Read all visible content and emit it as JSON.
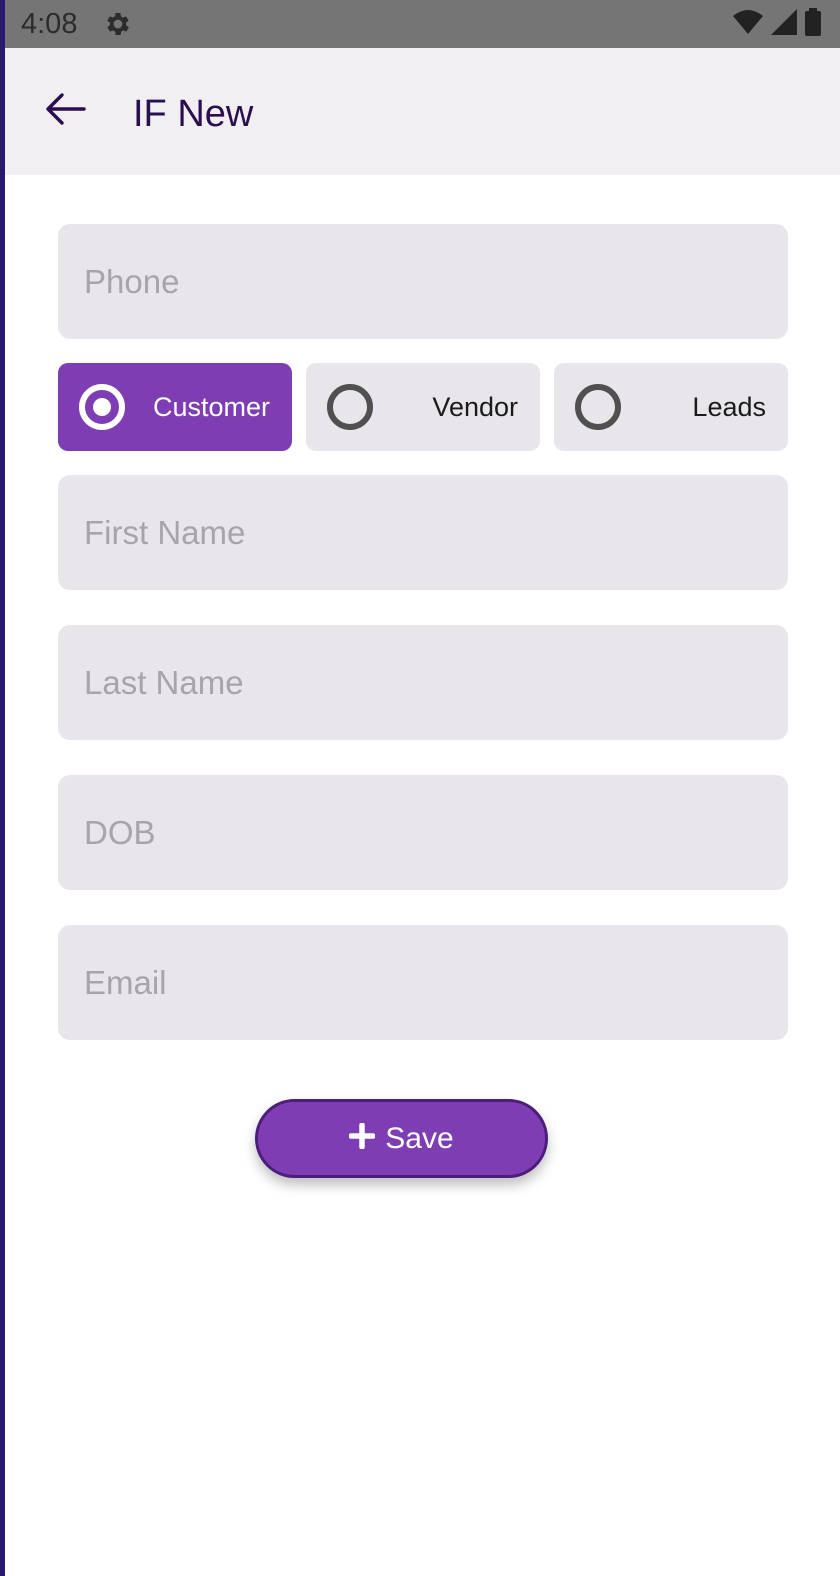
{
  "status_bar": {
    "time": "4:08",
    "icons": [
      "gear-icon",
      "wifi-icon",
      "signal-icon",
      "battery-icon"
    ]
  },
  "app_bar": {
    "title": "IF New",
    "back_icon": "arrow-left-icon"
  },
  "form": {
    "phone": {
      "placeholder": "Phone",
      "value": ""
    },
    "contact_type": {
      "options": [
        "Customer",
        "Vendor",
        "Leads"
      ],
      "selected": "Customer"
    },
    "first_name": {
      "placeholder": "First Name",
      "value": ""
    },
    "last_name": {
      "placeholder": "Last Name",
      "value": ""
    },
    "dob": {
      "placeholder": "DOB",
      "value": ""
    },
    "email": {
      "placeholder": "Email",
      "value": ""
    }
  },
  "save_button": {
    "label": "Save",
    "icon": "plus-icon"
  },
  "colors": {
    "accent": "#7e3db2",
    "title": "#2a0e4f",
    "field_bg": "#e8e6eb",
    "status_bar": "#757575",
    "app_bar": "#f1eff2"
  }
}
